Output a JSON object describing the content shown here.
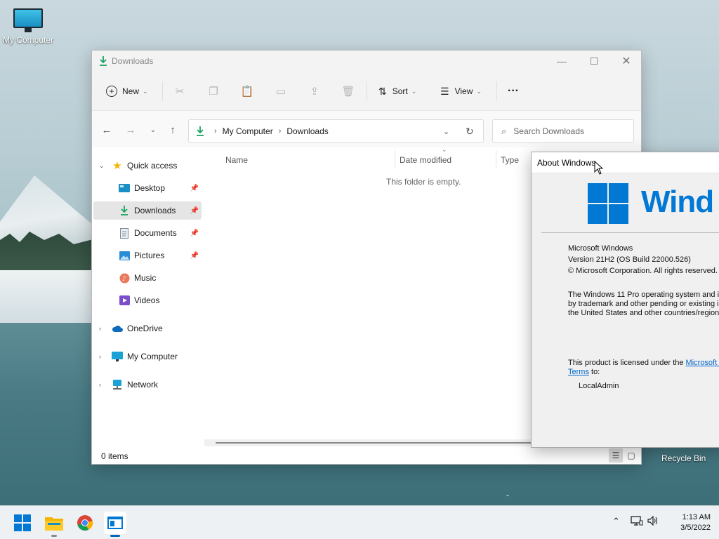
{
  "desktop": {
    "my_computer_label": "My Computer",
    "recycle_bin_label": "Recycle Bin"
  },
  "explorer": {
    "title": "Downloads",
    "toolbar": {
      "new_label": "New",
      "sort_label": "Sort",
      "view_label": "View",
      "more_label": "···"
    },
    "address": {
      "crumbs": [
        "My Computer",
        "Downloads"
      ]
    },
    "search": {
      "placeholder": "Search Downloads"
    },
    "nav": {
      "quick_access": "Quick access",
      "items": [
        {
          "label": "Desktop",
          "pinned": true
        },
        {
          "label": "Downloads",
          "pinned": true,
          "selected": true
        },
        {
          "label": "Documents",
          "pinned": true
        },
        {
          "label": "Pictures",
          "pinned": true
        },
        {
          "label": "Music",
          "pinned": false
        },
        {
          "label": "Videos",
          "pinned": false
        }
      ],
      "onedrive": "OneDrive",
      "my_computer": "My Computer",
      "network": "Network"
    },
    "columns": {
      "name": "Name",
      "date_modified": "Date modified",
      "type": "Type"
    },
    "empty_message": "This folder is empty.",
    "status": {
      "item_count": "0 items"
    }
  },
  "about": {
    "title": "About Windows",
    "brand": "Wind",
    "line1": "Microsoft Windows",
    "line2": "Version 21H2 (OS Build 22000.526)",
    "line3": "© Microsoft Corporation. All rights reserved.",
    "para1_l1": "The Windows 11 Pro operating system and it",
    "para1_l2": "by trademark and other pending or existing i",
    "para1_l3": "the United States and other countries/region",
    "license_prefix": "This product is licensed under the ",
    "license_link": "Microsoft S",
    "license_link2": "Terms",
    "license_suffix": " to:",
    "licensee": "LocalAdmin"
  },
  "taskbar": {
    "time": "1:13 AM",
    "date": "3/5/2022"
  },
  "colors": {
    "accent": "#0078d4",
    "folder_download_green": "#1aa260"
  }
}
